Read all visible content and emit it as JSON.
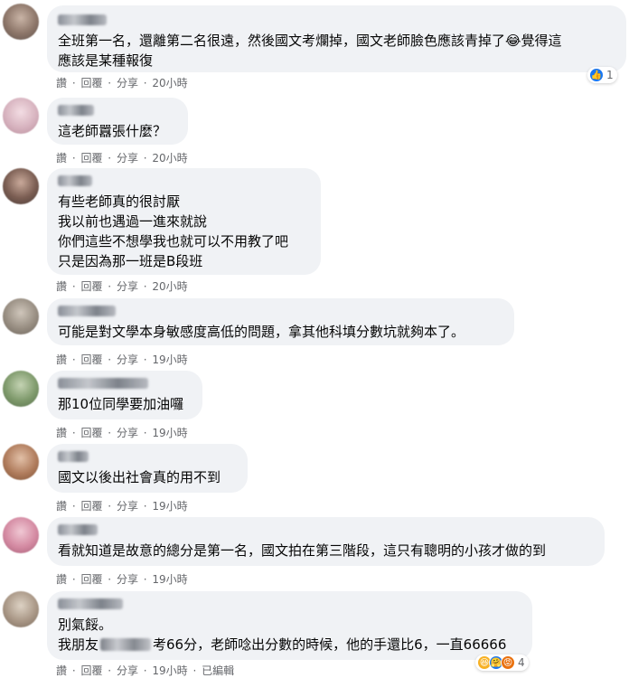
{
  "actions": {
    "like": "讚",
    "reply": "回覆",
    "share": "分享",
    "dot": " · ",
    "edited": "已編輯"
  },
  "comments": [
    {
      "text": "全班第一名，還離第二名很遠，然後國文考爛掉，國文老師臉色應該青掉了😂覺得這\n應該是某種報復",
      "time": "20小時",
      "reaction_count": "1"
    },
    {
      "text": "這老師囂張什麼？",
      "time": "20小時"
    },
    {
      "text": "有些老師真的很討厭\n我以前也遇過一進來就說\n你們這些不想學我也就可以不用教了吧\n只是因為那一班是B段班",
      "time": "20小時"
    },
    {
      "text": "可能是對文學本身敏感度高低的問題，拿其他科填分數坑就夠本了。",
      "time": "19小時"
    },
    {
      "text": "那10位同學要加油囉",
      "time": "19小時"
    },
    {
      "text": "國文以後出社會真的用不到",
      "time": "19小時"
    },
    {
      "text": "看就知道是故意的總分是第一名，國文拍在第三階段，這只有聰明的小孩才做的到",
      "time": "19小時"
    },
    {
      "text_a": "別氣餒。",
      "text_b_pre": "我朋友",
      "text_b_post": "考66分，老師唸出分數的時候，他的手還比6，一直66666",
      "time": "19小時",
      "reaction_count": "4"
    }
  ],
  "colors": {
    "bubble": "#f0f2f5",
    "meta": "#65676b",
    "like": "#1877f2"
  }
}
